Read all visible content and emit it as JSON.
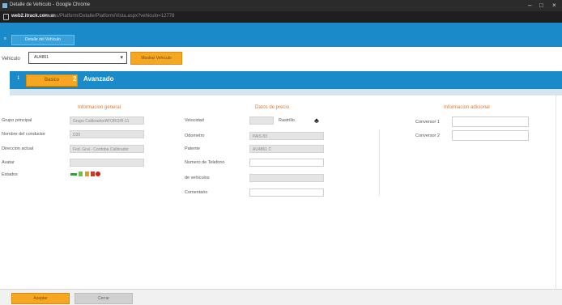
{
  "window": {
    "title": "Detalle de Vehiculo - Google Chrome"
  },
  "url": {
    "host": "web2.itrack.com.ar",
    "path": "/ventas/Platform/Detalle/Platform/Vista.aspx?vehiculo=12778"
  },
  "top_tab": {
    "label": "Detalle del Vehiculo"
  },
  "vehicle": {
    "label": "Vehiculo",
    "selected": "AU4861",
    "show_button": "Mostrar Vehiculo"
  },
  "steps": [
    {
      "num": "1",
      "label": "Basico"
    },
    {
      "num": "2",
      "label": "Avanzado"
    }
  ],
  "general": {
    "title": "Informacion general",
    "fields": [
      {
        "label": "Grupo principal",
        "value": "Grupo Calibrador/AFORO/R-11"
      },
      {
        "label": "Nombre del conductor",
        "value": "D20"
      },
      {
        "label": "Direccion actual",
        "value": "Fed. Gral - Cordoba Calibrador"
      },
      {
        "label": "Avatar",
        "value": ""
      },
      {
        "label": "Estados",
        "value": ""
      }
    ]
  },
  "device": {
    "title": "Datos de precio",
    "fields": [
      {
        "label": "Velocidad",
        "value": "",
        "extra": "Rastrillo"
      },
      {
        "label": "Odometro",
        "value": "PAIS 83"
      },
      {
        "label": "Patente",
        "value": "AU4861 C"
      },
      {
        "label": "Numero de Telefono",
        "value": ""
      },
      {
        "label": "de vehiculos",
        "value": ""
      },
      {
        "label": "Comentario",
        "value": ""
      }
    ]
  },
  "additional": {
    "title": "Informacion adicional",
    "fields": [
      {
        "label": "Conversor 1",
        "value": ""
      },
      {
        "label": "Conversor 2",
        "value": ""
      }
    ]
  },
  "footer": {
    "accept": "Aceptar",
    "close": "Cerrar"
  },
  "icons": [
    "truck-icon",
    "battery-icon",
    "key-icon",
    "pin-icon",
    "alert-icon"
  ],
  "colors": {
    "blue": "#1b8ac8",
    "orange": "#f5a623",
    "section_title": "#e07a2c"
  }
}
